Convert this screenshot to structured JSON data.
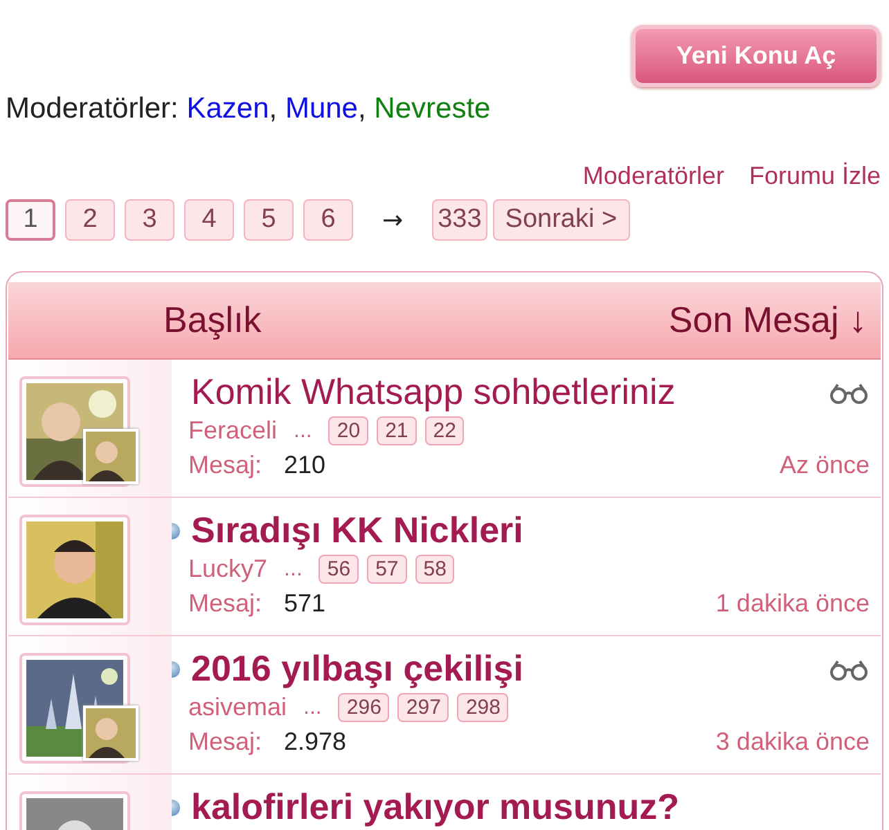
{
  "new_topic_button": "Yeni Konu Aç",
  "moderators": {
    "label": "Moderatörler:",
    "separator": ",",
    "names": [
      {
        "name": "Kazen",
        "color": "#1010e0"
      },
      {
        "name": "Mune",
        "color": "#1010e0"
      },
      {
        "name": "Nevreste",
        "color": "#108010"
      }
    ]
  },
  "links": [
    "Moderatörler",
    "Forumu İzle"
  ],
  "pagination": {
    "pages": [
      {
        "label": "1",
        "selected": true
      },
      {
        "label": "2",
        "selected": false
      },
      {
        "label": "3",
        "selected": false
      },
      {
        "label": "4",
        "selected": false
      },
      {
        "label": "5",
        "selected": false
      },
      {
        "label": "6",
        "selected": false
      }
    ],
    "separator": "→",
    "last": "333",
    "next": "Sonraki >"
  },
  "table": {
    "columns": [
      "Başlık",
      "Son Mesaj ↓"
    ],
    "rows": [
      {
        "title": "Komik Whatsapp sohbetleriniz",
        "unread": false,
        "watched": true,
        "second_avatar": true,
        "author": "Feraceli",
        "ellipsis": "...",
        "pages": [
          "20",
          "21",
          "22"
        ],
        "replies_label": "Mesaj:",
        "replies": "210",
        "last_post": "Az önce"
      },
      {
        "title": "Sıradışı KK Nickleri",
        "unread": true,
        "watched": false,
        "second_avatar": false,
        "author": "Lucky7",
        "ellipsis": "...",
        "pages": [
          "56",
          "57",
          "58"
        ],
        "replies_label": "Mesaj:",
        "replies": "571",
        "last_post": "1 dakika önce"
      },
      {
        "title": "2016 yılbaşı çekilişi",
        "unread": true,
        "watched": true,
        "second_avatar": true,
        "author": "asivemai",
        "ellipsis": "...",
        "pages": [
          "296",
          "297",
          "298"
        ],
        "replies_label": "Mesaj:",
        "replies": "2.978",
        "last_post": "3 dakika önce"
      },
      {
        "title": "kalofirleri yakıyor musunuz?",
        "unread": true,
        "watched": false,
        "second_avatar": false
      }
    ]
  }
}
